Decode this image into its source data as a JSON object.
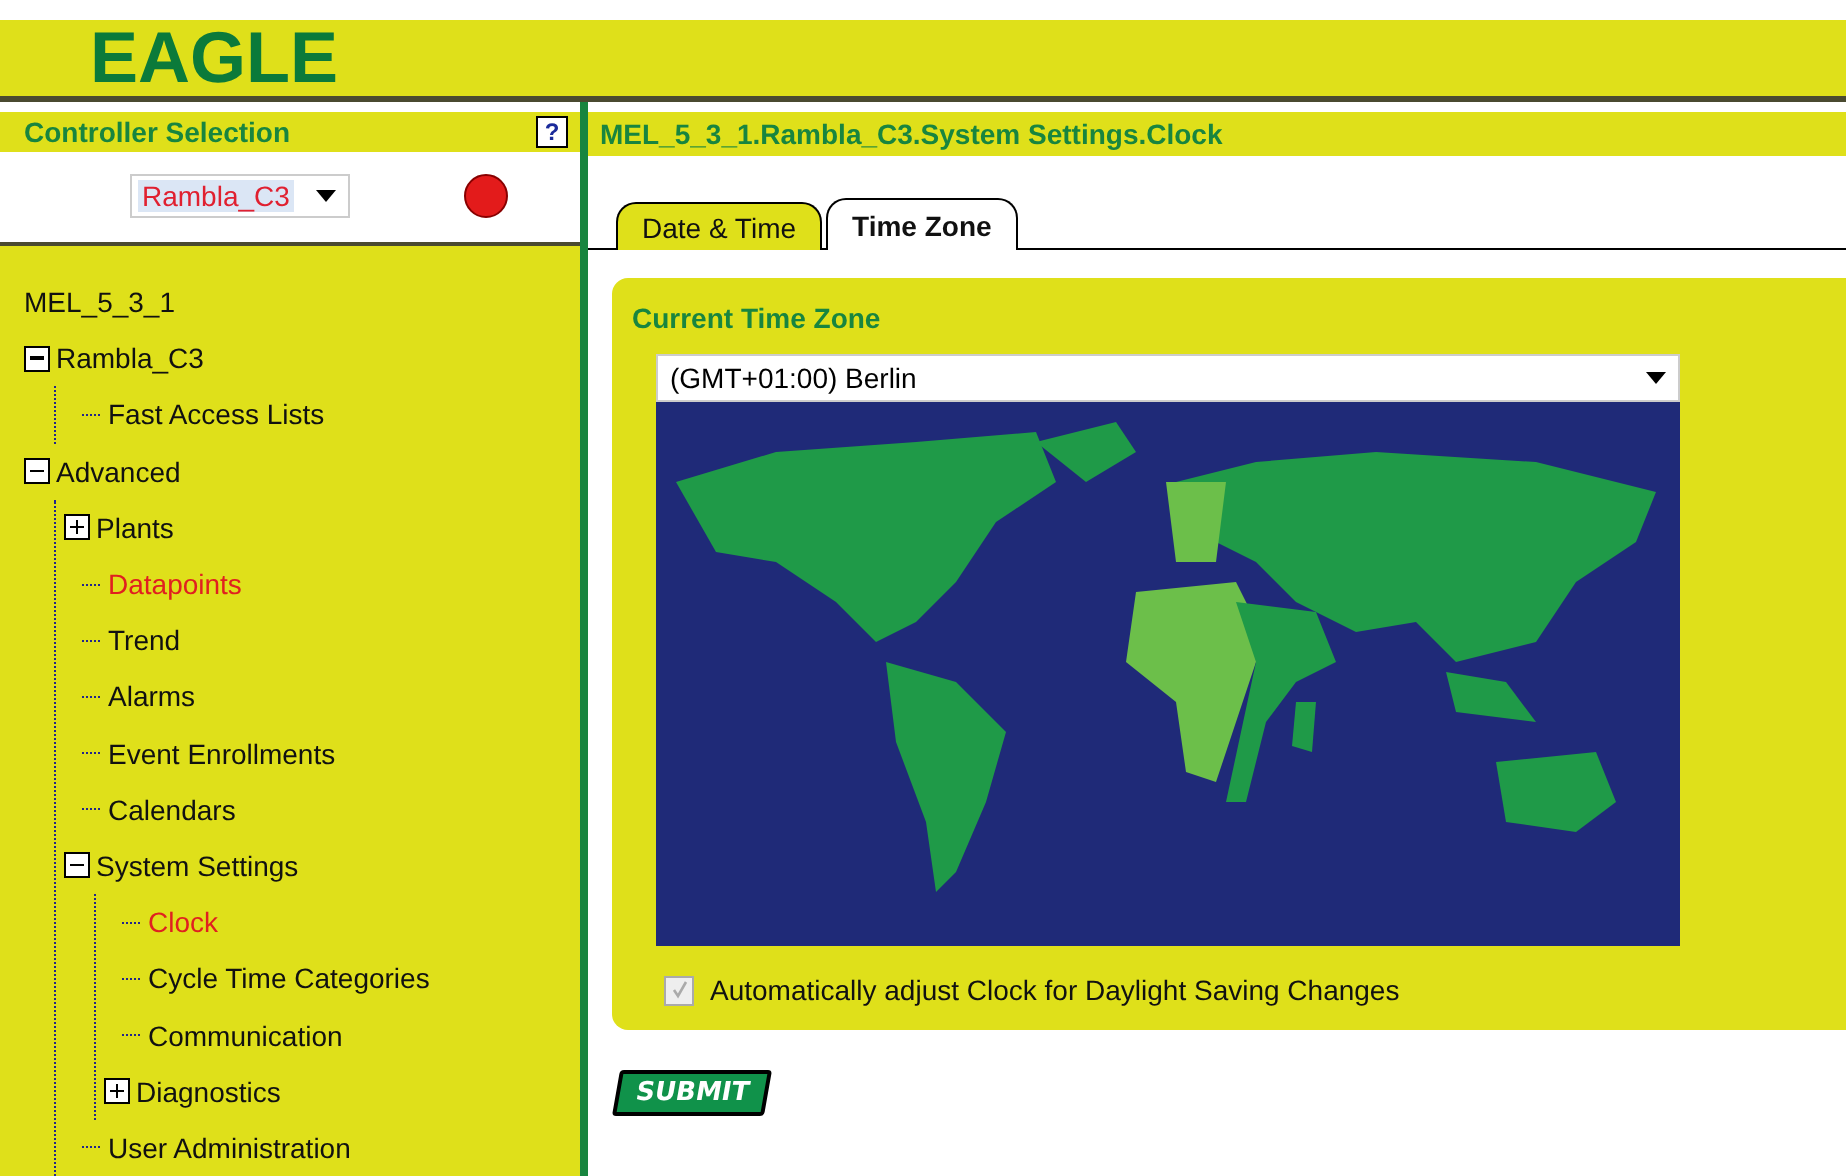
{
  "header": {
    "logo": "EAGLE"
  },
  "controller": {
    "title": "Controller Selection",
    "help": "?",
    "value": "Rambla_C3"
  },
  "tree": {
    "root": "MEL_5_3_1",
    "children": [
      {
        "label": "Rambla_C3",
        "expanded": true,
        "selected": false,
        "children": [
          {
            "label": "Fast Access Lists",
            "selected": false
          }
        ]
      },
      {
        "label": "Advanced",
        "expanded": true,
        "selected": false,
        "children": [
          {
            "label": "Plants",
            "expanded": false,
            "selected": false
          },
          {
            "label": "Datapoints",
            "selected": true
          },
          {
            "label": "Trend",
            "selected": false
          },
          {
            "label": "Alarms",
            "selected": false
          },
          {
            "label": "Event Enrollments",
            "selected": false
          },
          {
            "label": "Calendars",
            "selected": false
          },
          {
            "label": "System Settings",
            "expanded": true,
            "selected": false,
            "children": [
              {
                "label": "Clock",
                "selected": true
              },
              {
                "label": "Cycle Time Categories",
                "selected": false
              },
              {
                "label": "Communication",
                "selected": false
              },
              {
                "label": "Diagnostics",
                "expanded": false,
                "selected": false
              }
            ]
          },
          {
            "label": "User Administration",
            "selected": false
          }
        ]
      }
    ]
  },
  "breadcrumb": "MEL_5_3_1.Rambla_C3.System Settings.Clock",
  "tabs": [
    {
      "label": "Date & Time",
      "selected": false
    },
    {
      "label": "Time Zone",
      "selected": true
    }
  ],
  "panel": {
    "title": "Current Time Zone",
    "timezone": "(GMT+01:00) Berlin",
    "dst": {
      "label": "Automatically adjust Clock for Daylight Saving Changes",
      "checked": true,
      "disabled": true
    }
  },
  "submit": "SUBMIT"
}
